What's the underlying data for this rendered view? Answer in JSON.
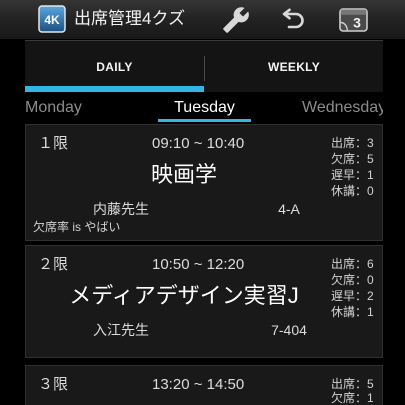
{
  "app": {
    "title": "出席管理4クズ",
    "icon": "app-icon",
    "icon_text": "4K"
  },
  "action_bar": {
    "actions": [
      {
        "icon": "wrench-icon"
      },
      {
        "icon": "undo-icon"
      },
      {
        "icon": "calendar-icon"
      }
    ],
    "calendar_day": "3"
  },
  "tabs": [
    {
      "label": "DAILY",
      "selected": true
    },
    {
      "label": "WEEKLY",
      "selected": false
    }
  ],
  "day_pager": {
    "previous": "Monday",
    "current": "Tuesday",
    "next": "Wednesday"
  },
  "stat_separator": "：",
  "periods": [
    {
      "period": "１限",
      "time": "09:10 ~ 10:40",
      "subject": "映画学",
      "teacher": "内藤先生",
      "room": "4-A",
      "note": "欠席率 is やばい",
      "stats": [
        {
          "label": "出席",
          "value": "3"
        },
        {
          "label": "欠席",
          "value": "5"
        },
        {
          "label": "遅早",
          "value": "1"
        },
        {
          "label": "休講",
          "value": "0"
        }
      ]
    },
    {
      "period": "２限",
      "time": "10:50 ~ 12:20",
      "subject": "メディアデザイン実習J",
      "teacher": "入江先生",
      "room": "7-404",
      "stats": [
        {
          "label": "出席",
          "value": "6"
        },
        {
          "label": "欠席",
          "value": "0"
        },
        {
          "label": "遅早",
          "value": "2"
        },
        {
          "label": "休講",
          "value": "1"
        }
      ]
    },
    {
      "period": "３限",
      "time": "13:20 ~ 14:50",
      "stats": [
        {
          "label": "出席",
          "value": "5"
        },
        {
          "label": "欠席",
          "value": "1"
        }
      ]
    }
  ],
  "colors": {
    "accent": "#33b5e5",
    "background": "#000000",
    "card": "#191919",
    "text_primary": "#ffffff",
    "text_secondary": "#8c8c8c"
  }
}
